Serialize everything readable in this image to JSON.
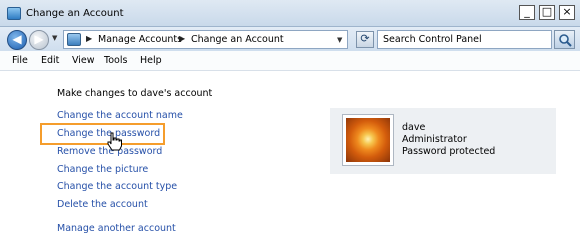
{
  "window": {
    "title": "Change an Account",
    "controls": {
      "minimize": "_",
      "maximize": "□",
      "close": "×"
    }
  },
  "address_bar": {
    "back_icon": "back-arrow-icon",
    "forward_icon": "forward-arrow-icon",
    "crumbs": [
      "Manage Accounts",
      "Change an Account"
    ],
    "search_placeholder": "Search Control Panel",
    "refresh_icon": "refresh-icon",
    "search_icon": "magnifier-icon"
  },
  "menu": [
    "File",
    "Edit",
    "View",
    "Tools",
    "Help"
  ],
  "main": {
    "heading": "Make changes to dave's account",
    "tasks": [
      "Change the account name",
      "Change the password",
      "Remove the password",
      "Change the picture",
      "Change the account type",
      "Delete the account"
    ],
    "other_task": "Manage another account",
    "highlight_color": "#f59d2c",
    "link_color": "#2650a8"
  },
  "account": {
    "name": "dave",
    "type": "Administrator",
    "status": "Password protected",
    "picture_icon": "flower-picture-icon"
  }
}
